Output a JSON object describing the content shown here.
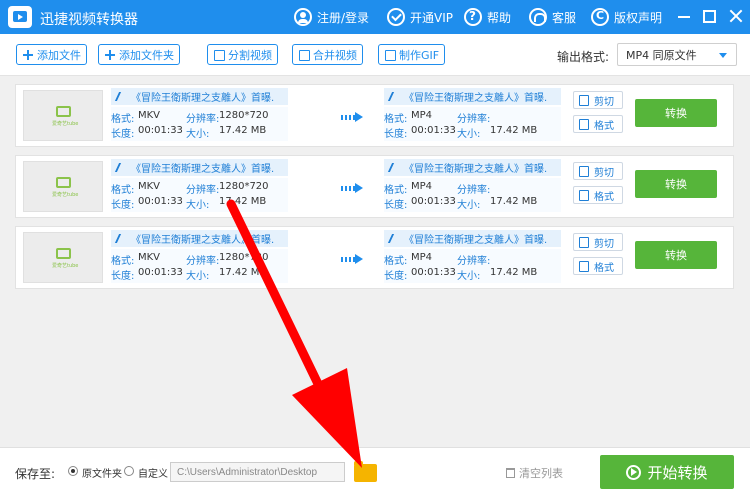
{
  "app": {
    "title": "迅捷视频转换器"
  },
  "titlebar": {
    "login": "注册/登录",
    "vip": "开通VIP",
    "help": "帮助",
    "service": "客服",
    "copyright": "版权声明"
  },
  "toolbar": {
    "add_file": "添加文件",
    "add_folder": "添加文件夹",
    "split_video": "分割视频",
    "merge_video": "合并视频",
    "make_gif": "制作GIF",
    "output_label": "输出格式:",
    "output_value": "MP4  同原文件"
  },
  "labels": {
    "format": "格式:",
    "resolution": "分辨率:",
    "duration": "长度:",
    "size": "大小:",
    "cut": "剪切",
    "format_btn": "格式",
    "convert": "转换",
    "thumb_brand": "爱奇艺tube"
  },
  "files": [
    {
      "name": "《冒险王衛斯理之支離人》首曝.",
      "out_name": "《冒险王衛斯理之支離人》首曝.",
      "format": "MKV",
      "resolution": "1280*720",
      "duration": "00:01:33",
      "size": "17.42 MB",
      "out_format": "MP4",
      "out_resolution": "",
      "out_duration": "00:01:33",
      "out_size": "17.42 MB"
    },
    {
      "name": "《冒险王衛斯理之支離人》首曝.",
      "out_name": "《冒险王衛斯理之支離人》首曝.",
      "format": "MKV",
      "resolution": "1280*720",
      "duration": "00:01:33",
      "size": "17.42 MB",
      "out_format": "MP4",
      "out_resolution": "",
      "out_duration": "00:01:33",
      "out_size": "17.42 MB"
    },
    {
      "name": "《冒险王衛斯理之支離人》首曝.",
      "out_name": "《冒险王衛斯理之支離人》首曝.",
      "format": "MKV",
      "resolution": "1280*720",
      "duration": "00:01:33",
      "size": "17.42 MB",
      "out_format": "MP4",
      "out_resolution": "",
      "out_duration": "00:01:33",
      "out_size": "17.42 MB"
    }
  ],
  "bottom": {
    "save_to": "保存至:",
    "opt_original": "原文件夹",
    "opt_custom": "自定义",
    "path": "C:\\Users\\Administrator\\Desktop",
    "clear_list": "清空列表",
    "start": "开始转换"
  },
  "colors": {
    "accent": "#1f8eed",
    "success": "#56b53a",
    "annotation": "#ff0000"
  }
}
